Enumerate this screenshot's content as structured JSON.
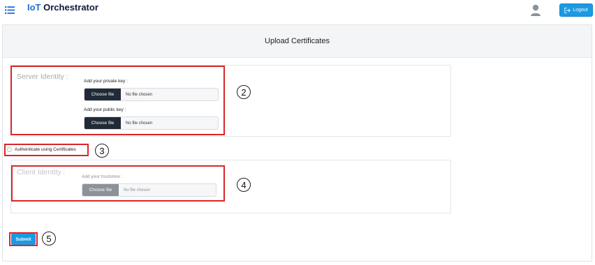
{
  "header": {
    "app_title_prefix": "IoT",
    "app_title_suffix": "Orchestrator",
    "menu_icon": "hamburger-list-icon",
    "user_icon": "user-avatar-icon",
    "logout_label": "Logout",
    "logout_icon": "logout-arrow-icon"
  },
  "panel": {
    "title": "Upload Certificates"
  },
  "server_identity": {
    "title": "Server Identity :",
    "private_key_label": "Add your private key :",
    "public_key_label": "Add your public key :",
    "choose_file_label": "Choose file",
    "private_key_status": "No file chosen",
    "public_key_status": "No file chosen"
  },
  "auth": {
    "label": "Authenticate using Certificates",
    "checked": false
  },
  "client_identity": {
    "title": "Client Identity :",
    "truststore_label": "Add your truststore :",
    "choose_file_label": "Choose file",
    "truststore_status": "No file chosen"
  },
  "submit_label": "Submit",
  "markers": [
    "2",
    "3",
    "4",
    "5"
  ],
  "colors": {
    "accent": "#1a9ae3",
    "highlight": "#d8262a",
    "file_button": "#212a37",
    "file_button_disabled": "#8d9298"
  }
}
